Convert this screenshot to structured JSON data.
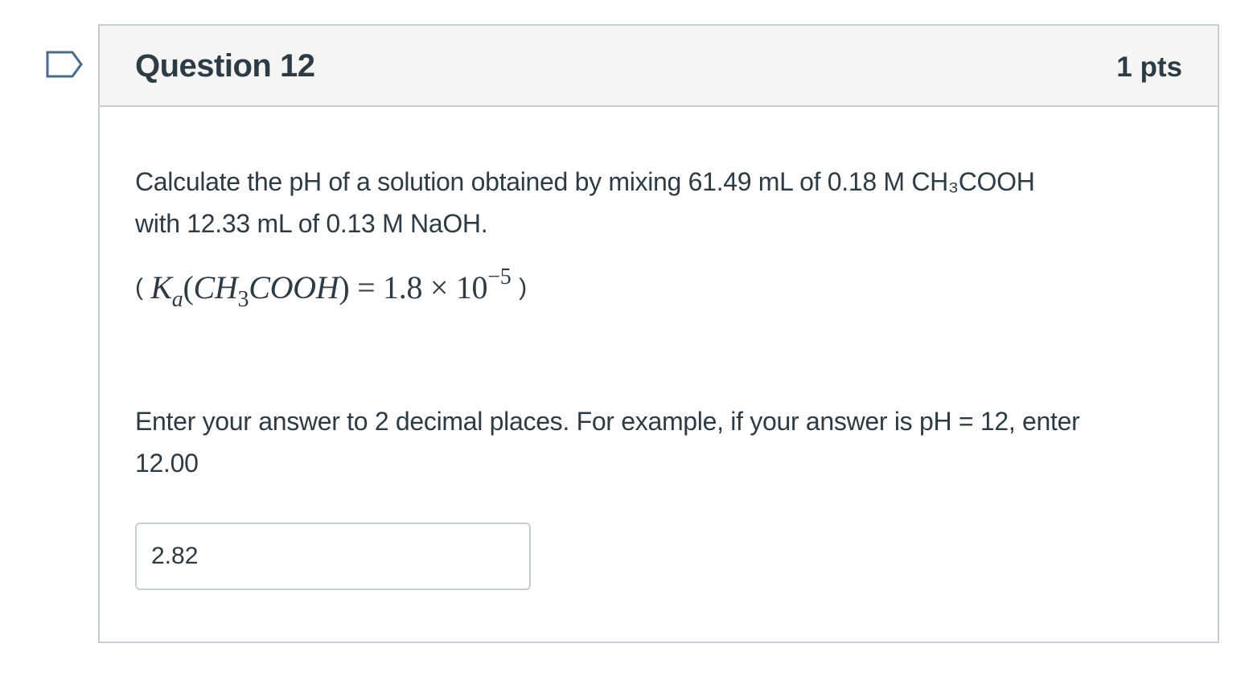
{
  "flag": {
    "icon": "bookmark-flag-icon",
    "color": "#4b6a8a"
  },
  "question": {
    "title": "Question 12",
    "points": "1 pts",
    "body_line1": "Calculate the pH of a solution obtained by mixing 61.49 mL of 0.18 M CH₃COOH",
    "body_line2": "with 12.33 mL of 0.13 M NaOH.",
    "formula": {
      "open": "(",
      "K": "K",
      "a_sub": "a",
      "lparen": "(",
      "species_left": "CH",
      "species_sub": "3",
      "species_right": "COOH",
      "rparen": ")",
      "equals": "=",
      "coefficient": "1.8",
      "times": "×",
      "base": "10",
      "exponent": "−5",
      "close": ")"
    },
    "instruction_line1": "Enter your answer to 2 decimal places. For example, if your answer is pH = 12, enter",
    "instruction_line2": "12.00",
    "answer_value": "2.82"
  },
  "colors": {
    "text": "#2d3b45",
    "border": "#c7cdd1",
    "header_bg": "#f5f5f5"
  }
}
